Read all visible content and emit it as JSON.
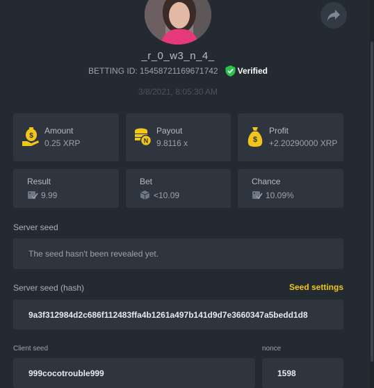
{
  "header": {
    "username": "_r_0_w3_n_4_",
    "betting_id": "BETTING ID: 15458721169671742",
    "verified_label": "Verified",
    "datetime": "3/8/2021, 8:05:30 AM"
  },
  "stats": {
    "amount": {
      "label": "Amount",
      "value": "0.25 XRP",
      "icon": "money-bag-hand-icon"
    },
    "payout": {
      "label": "Payout",
      "value": "9.8116 x",
      "icon": "coin-stack-icon"
    },
    "profit": {
      "label": "Profit",
      "value": "+2.20290000 XRP",
      "icon": "money-bag-icon"
    },
    "result": {
      "label": "Result",
      "value": "9.99",
      "icon": "dice-check-icon"
    },
    "bet": {
      "label": "Bet",
      "value": "<10.09",
      "icon": "dice-icon"
    },
    "chance": {
      "label": "Chance",
      "value": "10.09%",
      "icon": "dice-check-icon"
    }
  },
  "server_seed": {
    "label": "Server seed",
    "value": "The seed hasn't been revealed yet."
  },
  "server_seed_hash": {
    "label": "Server seed (hash)",
    "settings_label": "Seed settings",
    "value": "9a3f312984d2c686f112483ffa4b1261a497b141d9d7e3660347a5bedd1d8"
  },
  "client_seed": {
    "label": "Client seed",
    "value": "999cocotrouble999"
  },
  "nonce": {
    "label": "nonce",
    "value": "1598"
  },
  "colors": {
    "background": "#242a31",
    "card": "#2e353e",
    "accent_yellow": "#f2c51a",
    "verified_green": "#2dc24e"
  }
}
